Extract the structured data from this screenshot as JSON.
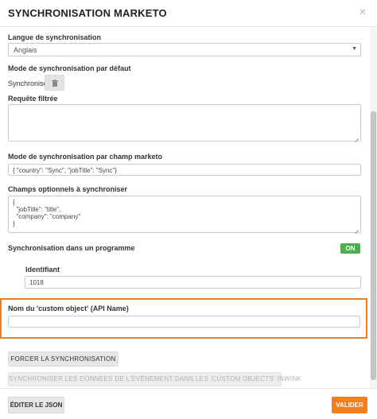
{
  "modal": {
    "title": "SYNCHRONISATION MARKETO",
    "close_glyph": "×"
  },
  "language": {
    "label": "Langue de synchronisation",
    "selected": "Anglais",
    "arrow_glyph": "▼"
  },
  "default_mode": {
    "label": "Mode de synchronisation par défaut",
    "value": "Synchroniser",
    "button_icon": "trash-icon"
  },
  "filtered_query": {
    "label": "Requête filtrée",
    "value": ""
  },
  "field_mode": {
    "label": "Mode de synchronisation par champ marketo",
    "value": "{ \"country\": \"Sync\", \"jobTitle\": \"Sync\"}"
  },
  "optional_fields": {
    "label": "Champs optionnels à synchroniser",
    "value": "{\n  \"jobTitle\": \"title\",\n  \"company\": \"company\"\n}"
  },
  "program_sync": {
    "label": "Synchronisation dans un programme",
    "toggle": "ON",
    "toggle_color": "#4cae4c",
    "id_label": "Identifiant",
    "id_value": "1018"
  },
  "custom_object": {
    "label": "Nom du 'custom object' (API Name)",
    "value": "",
    "highlight_color": "#f07f1c"
  },
  "actions": {
    "force_sync": "FORCER LA SYNCHRONISATION",
    "sync_events": "SYNCHRONISER LES DONNÉES DE L'ÉVÉNEMENT DANS LES 'CUSTOM OBJECTS' INWINK"
  },
  "footer": {
    "edit_json": "ÉDITER LE JSON",
    "validate": "VALIDER",
    "accent_color": "#f07f1c"
  }
}
